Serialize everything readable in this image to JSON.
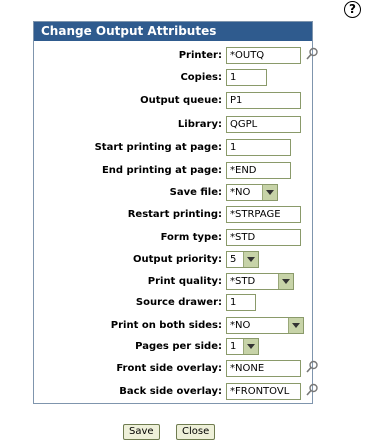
{
  "help": {
    "symbol": "?",
    "icon": "help-circle-icon"
  },
  "panel": {
    "title": "Change Output Attributes"
  },
  "fields": {
    "printer": {
      "label": "Printer:",
      "value": "*OUTQ"
    },
    "copies": {
      "label": "Copies:",
      "value": "1"
    },
    "output_queue": {
      "label": "Output queue:",
      "value": "P1"
    },
    "library": {
      "label": "Library:",
      "value": "QGPL"
    },
    "start_page": {
      "label": "Start printing at page:",
      "value": "1"
    },
    "end_page": {
      "label": "End printing at page:",
      "value": "*END"
    },
    "save_file": {
      "label": "Save file:",
      "value": "*NO"
    },
    "restart": {
      "label": "Restart printing:",
      "value": "*STRPAGE"
    },
    "form_type": {
      "label": "Form type:",
      "value": "*STD"
    },
    "priority": {
      "label": "Output priority:",
      "value": "5"
    },
    "quality": {
      "label": "Print quality:",
      "value": "*STD"
    },
    "drawer": {
      "label": "Source drawer:",
      "value": "1"
    },
    "both_sides": {
      "label": "Print on both sides:",
      "value": "*NO"
    },
    "pages_per_side": {
      "label": "Pages per side:",
      "value": "1"
    },
    "front_overlay": {
      "label": "Front side overlay:",
      "value": "*NONE"
    },
    "back_overlay": {
      "label": "Back side overlay:",
      "value": "*FRONTOVL"
    }
  },
  "buttons": {
    "save": "Save",
    "close": "Close"
  }
}
